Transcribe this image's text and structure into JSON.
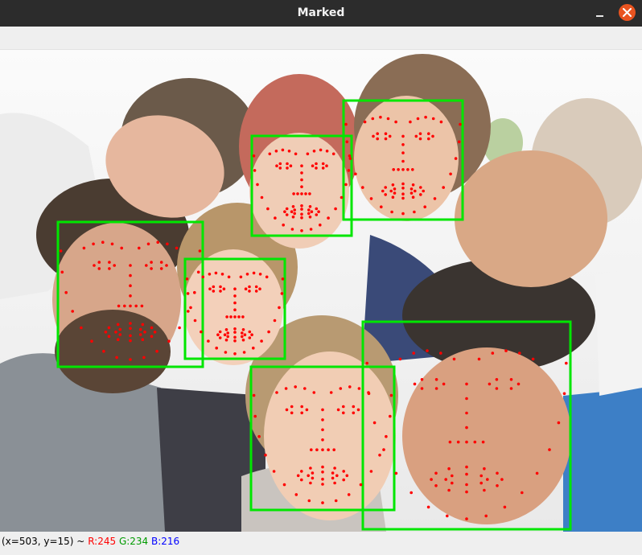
{
  "window": {
    "title": "Marked"
  },
  "colors": {
    "box": "#00e600",
    "landmark": "#ff0000",
    "close_button": "#e95420"
  },
  "icons": {
    "minimize": "minimize-icon",
    "close": "close-icon"
  },
  "status": {
    "coords": "(x=503, y=15) ~",
    "r": "R:245",
    "g": "G:234",
    "b": "B:216"
  }
}
